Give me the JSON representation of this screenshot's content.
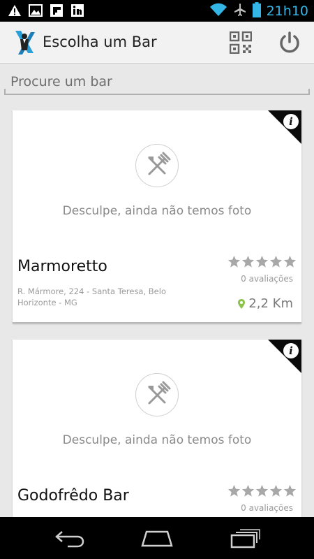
{
  "status_bar": {
    "time": "21h10",
    "icons_left": [
      "warning-icon",
      "image-icon",
      "flipboard-icon",
      "linkedin-icon"
    ],
    "icons_right": [
      "wifi-icon",
      "airplane-icon",
      "battery-icon"
    ]
  },
  "action_bar": {
    "title": "Escolha um Bar",
    "actions": [
      "qr-code-icon",
      "power-icon"
    ]
  },
  "search": {
    "placeholder": "Procure um bar",
    "value": ""
  },
  "bars": [
    {
      "no_photo_text": "Desculpe, ainda não temos foto",
      "name": "Marmoretto",
      "rating": 0,
      "max_rating": 5,
      "reviews": "0 avaliações",
      "address": "R. Mármore, 224 - Santa Teresa, Belo Horizonte - MG",
      "distance": "2,2 Km"
    },
    {
      "no_photo_text": "Desculpe, ainda não temos foto",
      "name": "Godofrêdo Bar",
      "rating": 0,
      "max_rating": 5,
      "reviews": "0 avaliações",
      "address": "",
      "distance": ""
    }
  ],
  "info_label": "i",
  "colors": {
    "accent": "#33b5e5",
    "star_empty": "#a8a8a8",
    "pin": "#8bc34a"
  },
  "nav_bar": [
    "back-icon",
    "home-icon",
    "recent-apps-icon"
  ]
}
